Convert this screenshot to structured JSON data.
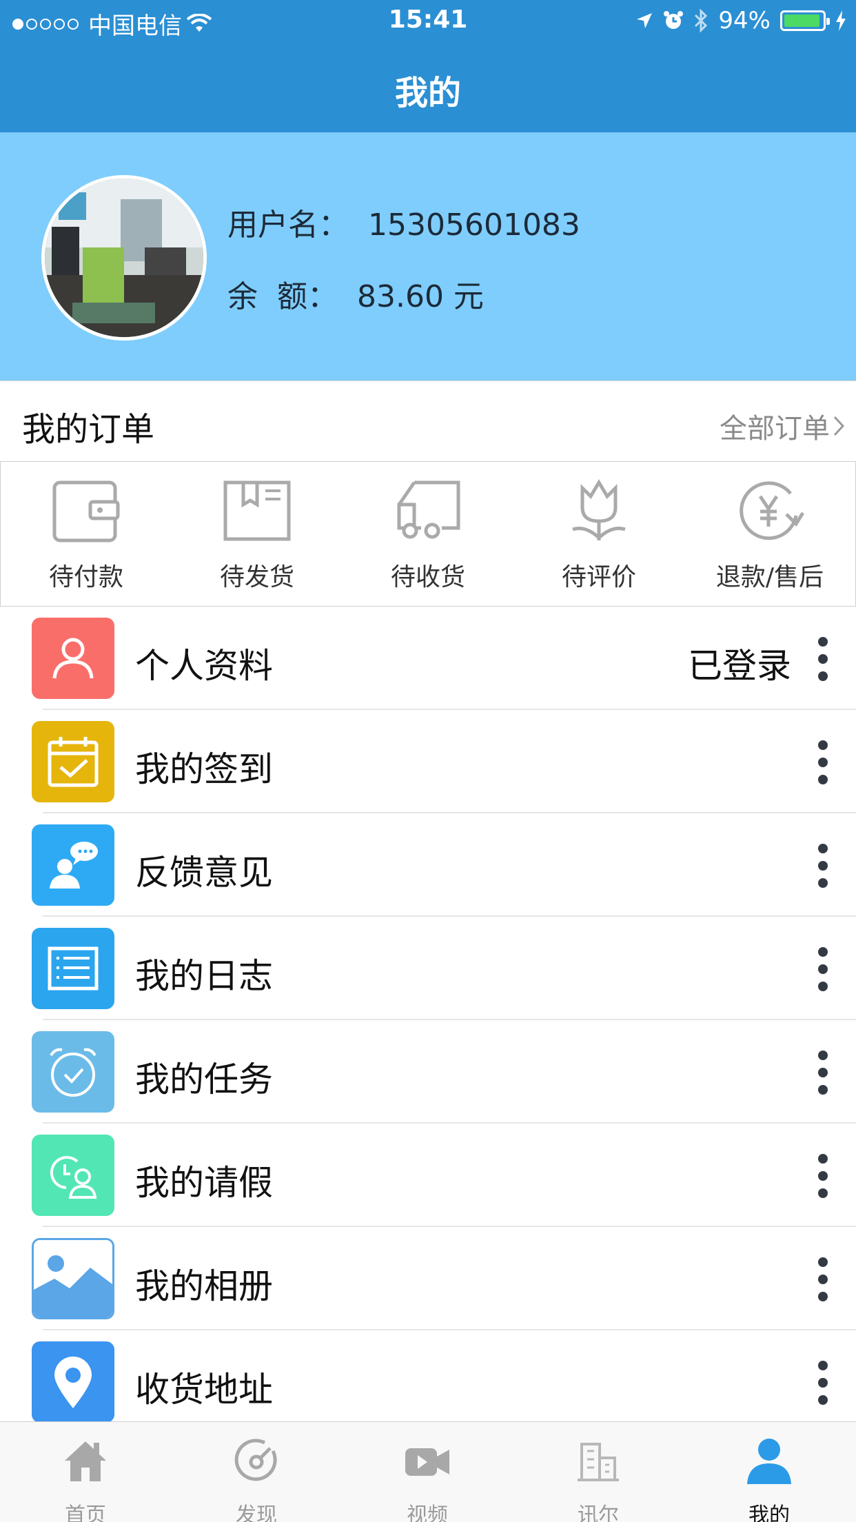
{
  "status_bar": {
    "carrier": "中国电信",
    "time": "15:41",
    "battery": "94%",
    "battery_level": 0.94,
    "signal_dots_filled": 1,
    "signal_dots_total": 5
  },
  "nav": {
    "title": "我的"
  },
  "profile": {
    "username_label": "用户名：",
    "username": "15305601083",
    "balance_label": "余  额：",
    "balance": "83.60 元"
  },
  "orders": {
    "title": "我的订单",
    "all_label": "全部订单",
    "items": [
      {
        "label": "待付款",
        "icon": "wallet-icon"
      },
      {
        "label": "待发货",
        "icon": "package-icon"
      },
      {
        "label": "待收货",
        "icon": "truck-icon"
      },
      {
        "label": "待评价",
        "icon": "tulip-icon"
      },
      {
        "label": "退款/售后",
        "icon": "refund-yen-icon"
      }
    ]
  },
  "menu": [
    {
      "label": "个人资料",
      "status": "已登录",
      "icon": "person-icon",
      "color": "#fa6e6a"
    },
    {
      "label": "我的签到",
      "status": "",
      "icon": "calendar-check-icon",
      "color": "#e5b50c"
    },
    {
      "label": "反馈意见",
      "status": "",
      "icon": "feedback-icon",
      "color": "#2eaaf5"
    },
    {
      "label": "我的日志",
      "status": "",
      "icon": "list-icon",
      "color": "#2aa5ee"
    },
    {
      "label": "我的任务",
      "status": "",
      "icon": "alarm-clock-icon",
      "color": "#6bbbe8"
    },
    {
      "label": "我的请假",
      "status": "",
      "icon": "leave-user-clock-icon",
      "color": "#52e6b4"
    },
    {
      "label": "我的相册",
      "status": "",
      "icon": "picture-icon",
      "color": "#5aa6e6"
    },
    {
      "label": "收货地址",
      "status": "",
      "icon": "location-pin-icon",
      "color": "#3b94f0"
    }
  ],
  "tabbar": {
    "items": [
      {
        "label": "首页",
        "icon": "home-icon",
        "active": false
      },
      {
        "label": "发现",
        "icon": "discover-icon",
        "active": false
      },
      {
        "label": "视频",
        "icon": "video-icon",
        "active": false
      },
      {
        "label": "讯尔",
        "icon": "building-icon",
        "active": false
      },
      {
        "label": "我的",
        "icon": "user-icon",
        "active": true
      }
    ],
    "active_color": "#2b9be8"
  }
}
